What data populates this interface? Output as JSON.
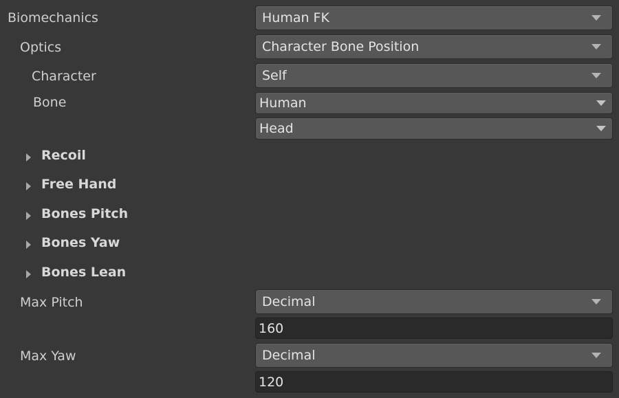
{
  "biomechanics": {
    "label": "Biomechanics",
    "value": "Human FK"
  },
  "optics": {
    "label": "Optics",
    "value": "Character Bone Position"
  },
  "character": {
    "label": "Character",
    "value": "Self"
  },
  "bone": {
    "label": "Bone",
    "value_primary": "Human",
    "value_secondary": "Head"
  },
  "foldouts": [
    {
      "label": "Recoil",
      "expanded": false
    },
    {
      "label": "Free Hand",
      "expanded": false
    },
    {
      "label": "Bones Pitch",
      "expanded": false
    },
    {
      "label": "Bones Yaw",
      "expanded": false
    },
    {
      "label": "Bones Lean",
      "expanded": false
    }
  ],
  "max_pitch": {
    "label": "Max Pitch",
    "type": "Decimal",
    "value": "160"
  },
  "max_yaw": {
    "label": "Max Yaw",
    "type": "Decimal",
    "value": "120"
  },
  "icons": {
    "dropdown_arrow": "triangle-down",
    "foldout_arrow": "triangle-right"
  },
  "colors": {
    "background": "#383838",
    "dropdown": "#575757",
    "field": "#2a2a2a",
    "text": "#d2d2d2"
  }
}
